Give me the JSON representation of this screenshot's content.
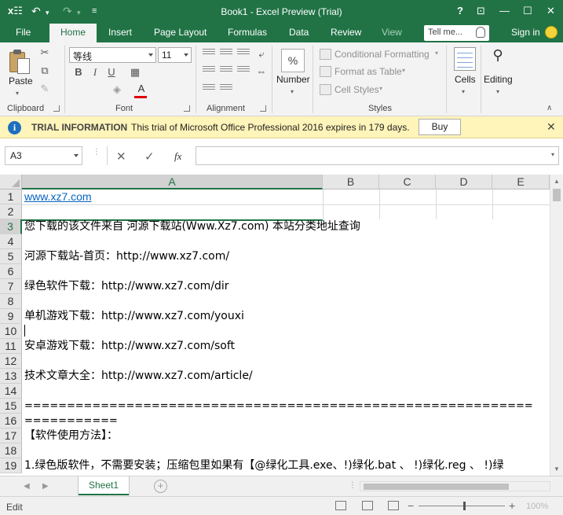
{
  "titlebar": {
    "title": "Book1 - Excel Preview (Trial)",
    "help": "?",
    "minimize": "—",
    "maximize": "☐",
    "close": "✕",
    "ribbon_display": "⊡"
  },
  "tabs": {
    "file": "File",
    "home": "Home",
    "insert": "Insert",
    "page_layout": "Page Layout",
    "formulas": "Formulas",
    "data": "Data",
    "review": "Review",
    "view": "View",
    "tell_me": "Tell me...",
    "sign_in": "Sign in"
  },
  "ribbon": {
    "clipboard": {
      "label": "Clipboard",
      "paste": "Paste"
    },
    "font": {
      "label": "Font",
      "name": "等线",
      "size": "11"
    },
    "alignment": {
      "label": "Alignment"
    },
    "number": {
      "label": "Number",
      "percent": "%"
    },
    "styles": {
      "label": "Styles",
      "conditional": "Conditional Formatting",
      "format_table": "Format as Table",
      "cell_styles": "Cell Styles"
    },
    "cells": {
      "label": "Cells"
    },
    "editing": {
      "label": "Editing"
    }
  },
  "trial": {
    "title": "TRIAL INFORMATION",
    "message": "This trial of Microsoft Office Professional 2016 expires in 179 days.",
    "buy": "Buy"
  },
  "formula_bar": {
    "name_box": "A3",
    "fx": "fx",
    "value": ""
  },
  "grid": {
    "columns": [
      "A",
      "B",
      "C",
      "D",
      "E"
    ],
    "rows": [
      "1",
      "2",
      "3",
      "4",
      "5",
      "6",
      "7",
      "8",
      "9",
      "10",
      "11",
      "12",
      "13",
      "14",
      "15",
      "16",
      "17",
      "18",
      "19"
    ],
    "cells": {
      "r1": "www.xz7.com",
      "r3": "您下载的该文件来自 河源下载站(Www.Xz7.com) 本站分类地址查询",
      "r5": "河源下载站-首页：http://www.xz7.com/",
      "r7": "绿色软件下载：http://www.xz7.com/dir",
      "r9": "单机游戏下载：http://www.xz7.com/youxi",
      "r11": "安卓游戏下载：http://www.xz7.com/soft",
      "r13": "技术文章大全：http://www.xz7.com/article/",
      "r15": "============================================================",
      "r16": "===========",
      "r17": "【软件使用方法】：",
      "r19": "1.绿色版软件，不需要安装；压缩包里如果有【@绿化工具.exe、!)绿化.bat 、 !)绿化.reg 、 !)绿"
    }
  },
  "sheets": {
    "active": "Sheet1",
    "add": "+"
  },
  "status": {
    "mode": "Edit",
    "zoom": "100%"
  }
}
